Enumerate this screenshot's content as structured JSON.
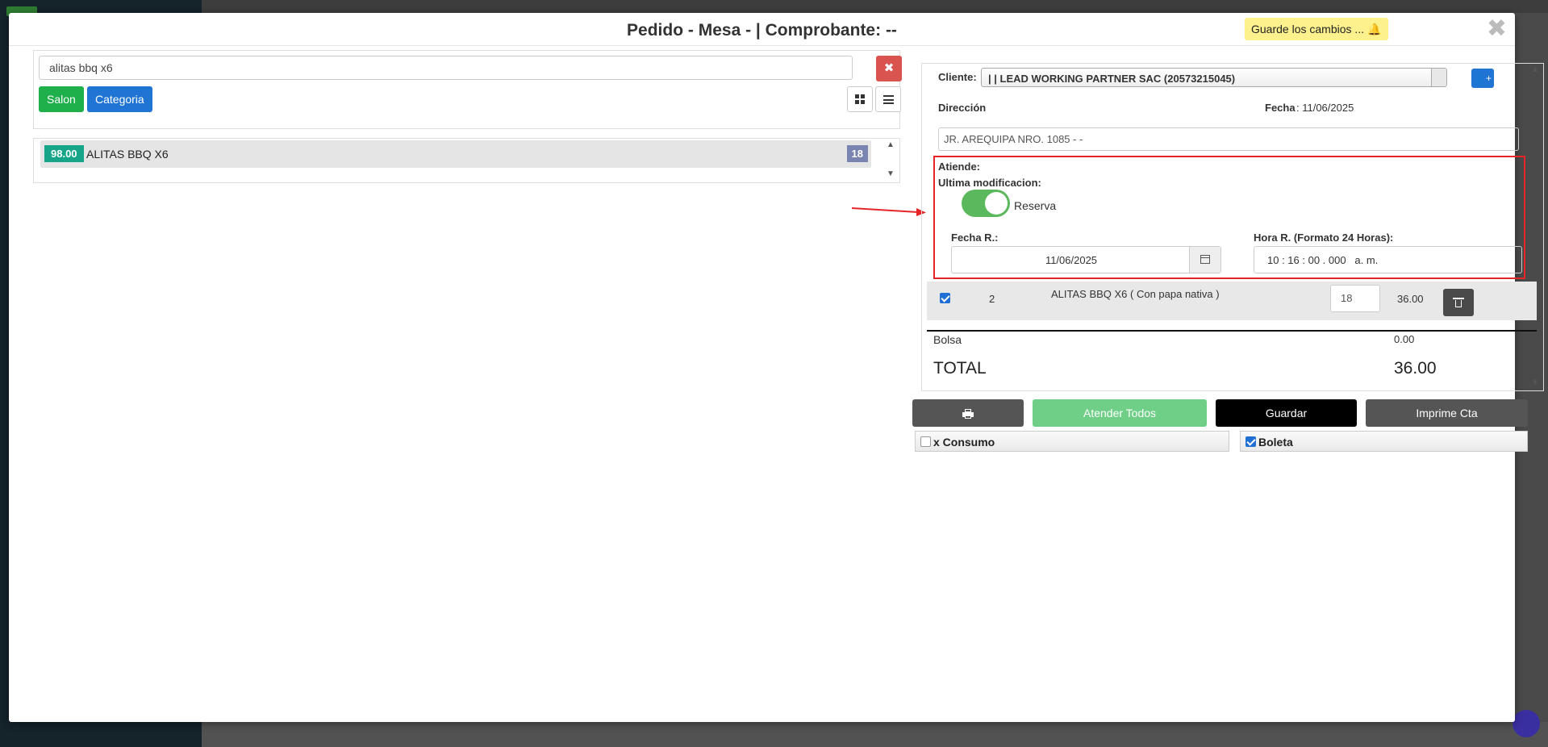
{
  "modal": {
    "title": "Pedido - Mesa - | Comprobante: --",
    "alert_text": "Guarde los cambios ...",
    "alert_icon": "bell-icon",
    "close_symbol": "✖"
  },
  "search": {
    "value": "alitas bbq x6",
    "clear_symbol": "✖"
  },
  "filters": {
    "salon_label": "Salon",
    "categoria_label": "Categoria"
  },
  "products": [
    {
      "price": "98.00",
      "name": "ALITAS BBQ X6",
      "stock": "18"
    }
  ],
  "order": {
    "cliente_label": "Cliente:",
    "cliente_value": "| | LEAD WORKING PARTNER SAC (20573215045)",
    "direccion_label": "Dirección",
    "direccion_value": "JR. AREQUIPA NRO. 1085 - -",
    "fecha_label": "Fecha",
    "fecha_value": ": 11/06/2025",
    "atiende_label": "Atiende:",
    "ultima_mod_label": "Ultima modificacion:",
    "reserva_label": "Reserva",
    "reserva_on": true,
    "fecha_r_label": "Fecha R.:",
    "fecha_r_value": "11/06/2025",
    "hora_r_label": "Hora R. (Formato 24 Horas):",
    "hora_r_value": "10 : 16 : 00 . 000   a. m.",
    "items": [
      {
        "checked": true,
        "qty": "2",
        "description": "ALITAS BBQ X6 ( Con papa nativa )",
        "price": "18",
        "subtotal": "36.00"
      }
    ],
    "bolsa_label": "Bolsa",
    "bolsa_value": "0.00",
    "total_label": "TOTAL",
    "total_value": "36.00"
  },
  "actions": {
    "print_icon": "print-icon",
    "atender_label": "Atender Todos",
    "guardar_label": "Guardar",
    "imprime_label": "Imprime Cta"
  },
  "options": {
    "consumo_label": "x Consumo",
    "consumo_checked": false,
    "boleta_label": "Boleta",
    "boleta_checked": true
  },
  "colors": {
    "accent_blue": "#1f74d4",
    "green": "#20b04b",
    "danger": "#d9534f",
    "highlight_red": "#e6252a",
    "price_badge": "#17a589",
    "atender_green": "#6fcf87"
  }
}
